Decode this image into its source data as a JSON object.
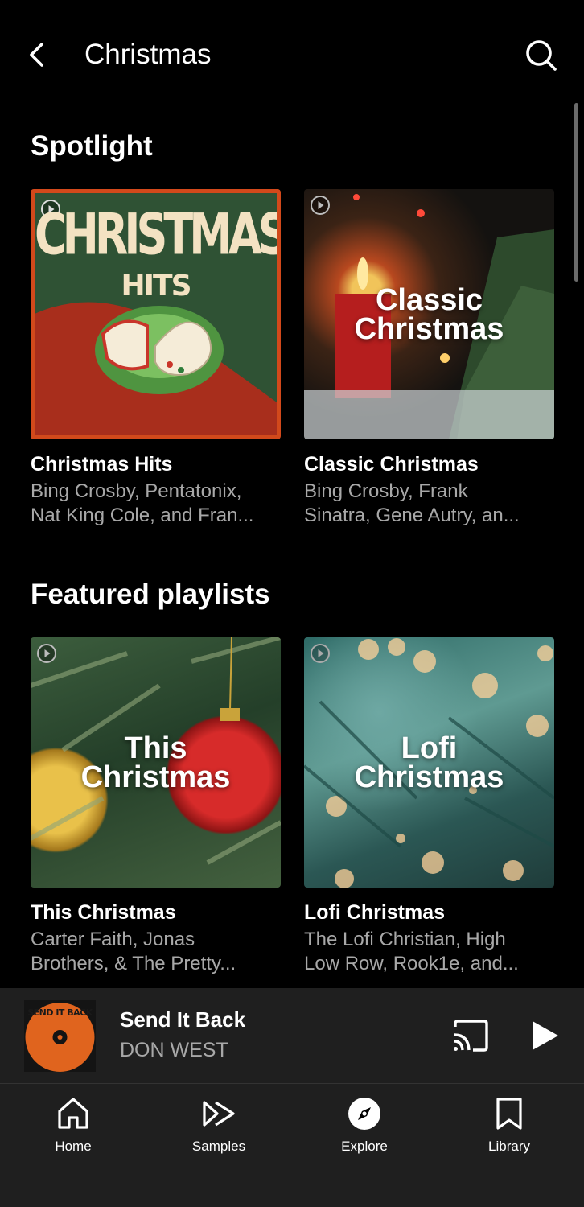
{
  "header": {
    "title": "Christmas"
  },
  "sections": [
    {
      "title": "Spotlight",
      "cards": [
        {
          "title": "Christmas Hits",
          "subtitle_line1": "Bing Crosby, Pentatonix,",
          "subtitle_line2": "Nat King Cole, and Fran...",
          "cover_text_main": "CHRISTMAS",
          "cover_text_sub": "HITS"
        },
        {
          "title": "Classic Christmas",
          "subtitle_line1": "Bing Crosby, Frank",
          "subtitle_line2": "Sinatra, Gene Autry, an...",
          "cover_text_line1": "Classic",
          "cover_text_line2": "Christmas"
        }
      ]
    },
    {
      "title": "Featured playlists",
      "cards": [
        {
          "title": "This Christmas",
          "subtitle_line1": "Carter Faith, Jonas",
          "subtitle_line2": "Brothers, & The Pretty...",
          "cover_text_line1": "This",
          "cover_text_line2": "Christmas"
        },
        {
          "title": "Lofi Christmas",
          "subtitle_line1": "The Lofi Christian, High",
          "subtitle_line2": "Low Row, Rook1e, and...",
          "cover_text_line1": "Lofi",
          "cover_text_line2": "Christmas"
        }
      ]
    }
  ],
  "mini_player": {
    "title": "Send It Back",
    "artist": "DON WEST",
    "art_text": "SEND IT BACK"
  },
  "bottom_nav": [
    {
      "label": "Home",
      "icon": "home-icon"
    },
    {
      "label": "Samples",
      "icon": "samples-icon"
    },
    {
      "label": "Explore",
      "icon": "explore-icon",
      "active": true
    },
    {
      "label": "Library",
      "icon": "library-icon"
    }
  ],
  "colors": {
    "background": "#000000",
    "player_bg": "#1f1f1f",
    "secondary_text": "#a8a8a8",
    "hits_border": "#d2491b"
  }
}
